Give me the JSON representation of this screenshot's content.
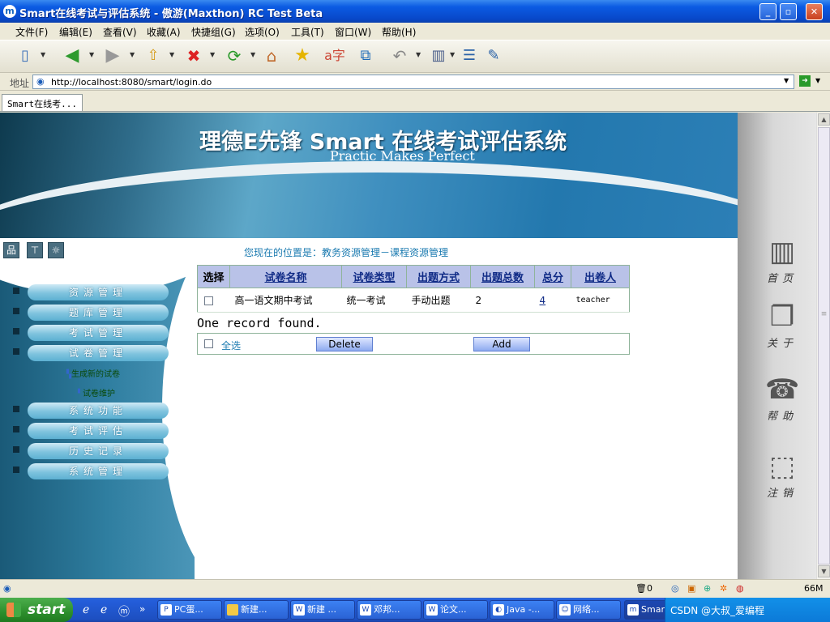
{
  "window": {
    "title": "Smart在线考试与评估系统 - 傲游(Maxthon) RC Test Beta"
  },
  "menu": [
    "文件(F)",
    "编辑(E)",
    "查看(V)",
    "收藏(A)",
    "快捷组(G)",
    "选项(O)",
    "工具(T)",
    "窗口(W)",
    "帮助(H)"
  ],
  "address": {
    "label": "地址",
    "url": "http://localhost:8080/smart/login.do"
  },
  "tab": {
    "label": "Smart在线考..."
  },
  "banner": {
    "title": "理德E先锋  Smart 在线考试评估系统",
    "subtitle": "Practic Makes Perfect"
  },
  "sidebar": {
    "items": [
      "资源管理",
      "题库管理",
      "考试管理",
      "试卷管理",
      "系统功能",
      "考试评估",
      "历史记录",
      "系统管理"
    ],
    "sub_items": [
      "生成新的试卷",
      "试卷维护"
    ]
  },
  "right_nav": [
    "首页",
    "关于",
    "帮助",
    "注销"
  ],
  "breadcrumb": "您现在的位置是：教务资源管理－课程资源管理",
  "table": {
    "headers": [
      "选择",
      "试卷名称",
      "试卷类型",
      "出题方式",
      "出题总数",
      "总分",
      "出卷人"
    ],
    "rows": [
      {
        "name": "高一语文期中考试",
        "type": "统一考试",
        "method": "手动出题",
        "count": "2",
        "score": "4",
        "author": "teacher"
      }
    ]
  },
  "found_text": "One record found.",
  "actions": {
    "select_all": "全选",
    "delete": "Delete",
    "add": "Add"
  },
  "status": {
    "trash": "0",
    "memory": "66M"
  },
  "taskbar": {
    "start": "start",
    "tasks": [
      "PC蛋...",
      "新建...",
      "新建 ...",
      "邓邦...",
      "论文...",
      "Java -...",
      "网络...",
      "Smart..."
    ],
    "tray_text": "CSDN @大叔_爱编程"
  },
  "colors": {
    "title_bar": "#0b5be3",
    "table_header": "#b9c2e8",
    "link": "#0f2a86",
    "nav_pill": "#7fc3de"
  }
}
